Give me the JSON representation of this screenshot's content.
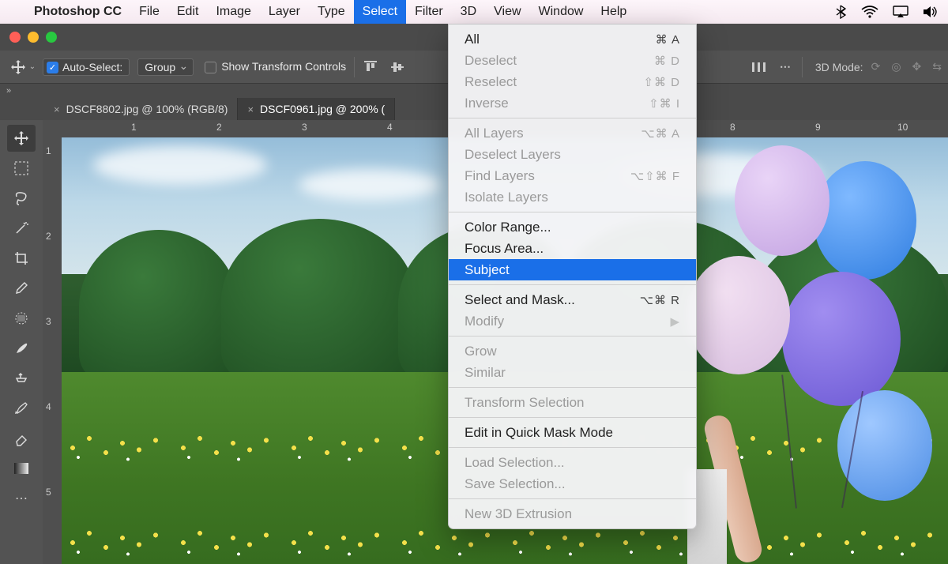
{
  "menubar": {
    "app": "Photoshop CC",
    "items": [
      "File",
      "Edit",
      "Image",
      "Layer",
      "Type",
      "Select",
      "Filter",
      "3D",
      "View",
      "Window",
      "Help"
    ],
    "active_index": 5
  },
  "options_bar": {
    "auto_select_label": "Auto-Select:",
    "auto_select_checked": true,
    "group_label": "Group",
    "show_transform_label": "Show Transform Controls",
    "mode3d_label": "3D Mode:"
  },
  "tabs": [
    {
      "close": "×",
      "label": "DSCF8802.jpg @ 100% (RGB/8)",
      "active": false
    },
    {
      "close": "×",
      "label": "DSCF0961.jpg @ 200% (",
      "active": true
    }
  ],
  "ruler_h": [
    "1",
    "2",
    "3",
    "4",
    "8",
    "9",
    "10"
  ],
  "ruler_v": [
    "1",
    "2",
    "3",
    "4",
    "5"
  ],
  "menu": {
    "groups": [
      [
        {
          "label": "All",
          "shortcut": "⌘ A",
          "disabled": false
        },
        {
          "label": "Deselect",
          "shortcut": "⌘ D",
          "disabled": true
        },
        {
          "label": "Reselect",
          "shortcut": "⇧⌘ D",
          "disabled": true
        },
        {
          "label": "Inverse",
          "shortcut": "⇧⌘ I",
          "disabled": true
        }
      ],
      [
        {
          "label": "All Layers",
          "shortcut": "⌥⌘ A",
          "disabled": true
        },
        {
          "label": "Deselect Layers",
          "shortcut": "",
          "disabled": true
        },
        {
          "label": "Find Layers",
          "shortcut": "⌥⇧⌘ F",
          "disabled": true
        },
        {
          "label": "Isolate Layers",
          "shortcut": "",
          "disabled": true
        }
      ],
      [
        {
          "label": "Color Range...",
          "shortcut": "",
          "disabled": false
        },
        {
          "label": "Focus Area...",
          "shortcut": "",
          "disabled": false
        },
        {
          "label": "Subject",
          "shortcut": "",
          "disabled": false,
          "highlight": true
        }
      ],
      [
        {
          "label": "Select and Mask...",
          "shortcut": "⌥⌘ R",
          "disabled": false
        },
        {
          "label": "Modify",
          "shortcut": "",
          "disabled": true,
          "submenu": true
        }
      ],
      [
        {
          "label": "Grow",
          "shortcut": "",
          "disabled": true
        },
        {
          "label": "Similar",
          "shortcut": "",
          "disabled": true
        }
      ],
      [
        {
          "label": "Transform Selection",
          "shortcut": "",
          "disabled": true
        }
      ],
      [
        {
          "label": "Edit in Quick Mask Mode",
          "shortcut": "",
          "disabled": false
        }
      ],
      [
        {
          "label": "Load Selection...",
          "shortcut": "",
          "disabled": true
        },
        {
          "label": "Save Selection...",
          "shortcut": "",
          "disabled": true
        }
      ],
      [
        {
          "label": "New 3D Extrusion",
          "shortcut": "",
          "disabled": true
        }
      ]
    ]
  },
  "tools": [
    "move",
    "marquee",
    "lasso",
    "wand",
    "crop",
    "eyedropper",
    "heal",
    "brush",
    "clone",
    "history",
    "eraser",
    "gradient"
  ]
}
